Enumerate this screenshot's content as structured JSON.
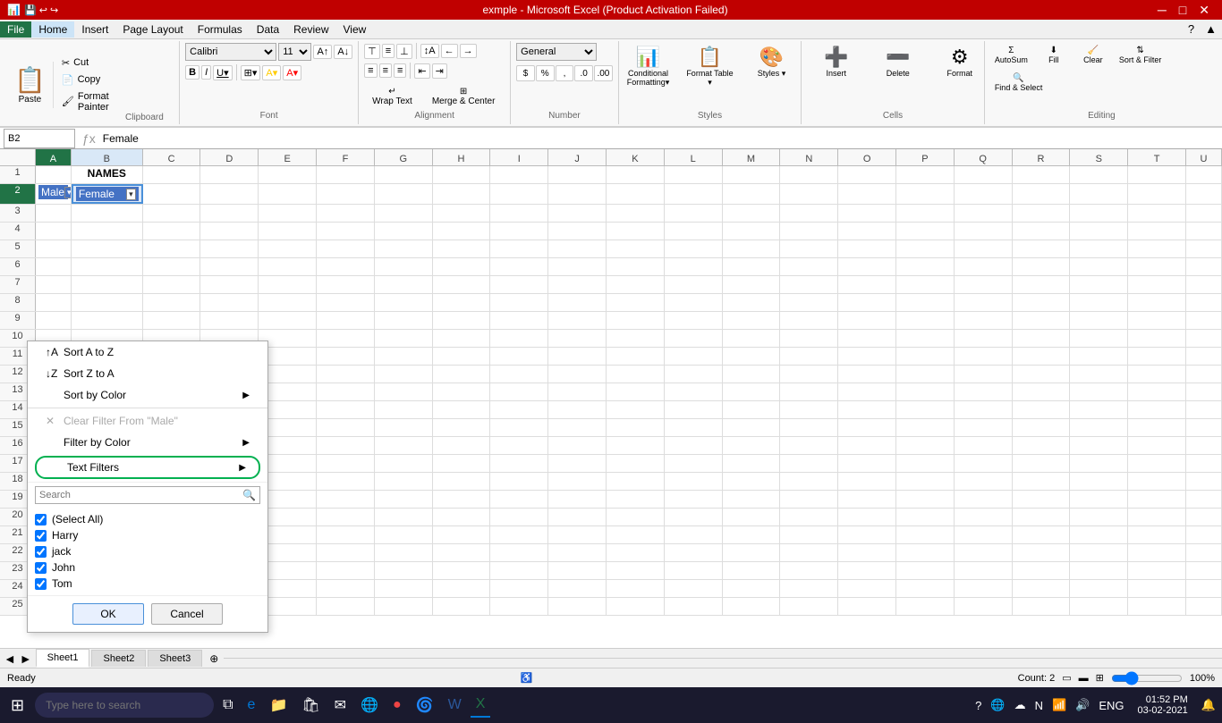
{
  "titleBar": {
    "title": "exmple - Microsoft Excel (Product Activation Failed)",
    "windowControls": [
      "_",
      "□",
      "✕"
    ]
  },
  "menuBar": {
    "items": [
      "File",
      "Home",
      "Insert",
      "Page Layout",
      "Formulas",
      "Data",
      "Review",
      "View"
    ]
  },
  "ribbon": {
    "clipboard": {
      "label": "Clipboard",
      "paste": "Paste",
      "cut": "Cut",
      "copy": "Copy",
      "formatPainter": "Format Painter"
    },
    "font": {
      "label": "Font",
      "fontName": "Calibri",
      "fontSize": "11",
      "bold": "B",
      "italic": "I",
      "underline": "U"
    },
    "alignment": {
      "label": "Alignment",
      "wrapText": "Wrap Text",
      "mergeCenter": "Merge & Center"
    },
    "number": {
      "label": "Number",
      "format": "General",
      "percent": "%",
      "comma": ","
    },
    "styles": {
      "label": "Styles",
      "conditionalFormatting": "Conditional Formatting",
      "formatAsTable": "Format Table",
      "cellStyles": "Cell Styles"
    },
    "cells": {
      "label": "Cells",
      "insert": "Insert",
      "delete": "Delete",
      "format": "Format"
    },
    "editing": {
      "label": "Editing",
      "autoSum": "AutoSum",
      "fill": "Fill",
      "clear": "Clear",
      "sortFilter": "Sort & Filter",
      "findSelect": "Find & Select"
    }
  },
  "formulaBar": {
    "cellRef": "B2",
    "formula": "Female"
  },
  "columns": [
    "A",
    "B",
    "C",
    "D",
    "E",
    "F",
    "G",
    "H",
    "I",
    "J",
    "K",
    "L",
    "M",
    "N",
    "O",
    "P",
    "Q",
    "R",
    "S",
    "T",
    "U"
  ],
  "rows": [
    {
      "num": 1,
      "cells": [
        "",
        "NAMES",
        "",
        "",
        "",
        "",
        "",
        "",
        "",
        "",
        "",
        "",
        "",
        "",
        "",
        "",
        "",
        "",
        "",
        "",
        ""
      ]
    },
    {
      "num": 2,
      "cells": [
        "",
        "Female",
        "",
        "",
        "",
        "",
        "",
        "",
        "",
        "",
        "",
        "",
        "",
        "",
        "",
        "",
        "",
        "",
        "",
        "",
        ""
      ]
    },
    {
      "num": 3,
      "cells": [
        "",
        "",
        "",
        "",
        "",
        "",
        "",
        "",
        "",
        "",
        "",
        "",
        "",
        "",
        "",
        "",
        "",
        "",
        "",
        "",
        ""
      ]
    },
    {
      "num": 4,
      "cells": [
        "",
        "",
        "",
        "",
        "",
        "",
        "",
        "",
        "",
        "",
        "",
        "",
        "",
        "",
        "",
        "",
        "",
        "",
        "",
        "",
        ""
      ]
    },
    {
      "num": 5,
      "cells": [
        "",
        "",
        "",
        "",
        "",
        "",
        "",
        "",
        "",
        "",
        "",
        "",
        "",
        "",
        "",
        "",
        "",
        "",
        "",
        "",
        ""
      ]
    }
  ],
  "dropdownMenu": {
    "items": [
      {
        "id": "sort-a-z",
        "label": "Sort A to Z",
        "icon": "↑",
        "disabled": false
      },
      {
        "id": "sort-z-a",
        "label": "Sort Z to A",
        "icon": "↓",
        "disabled": false
      },
      {
        "id": "sort-by-color",
        "label": "Sort by Color",
        "icon": "▶",
        "hasArrow": true,
        "disabled": false
      },
      {
        "sep": true
      },
      {
        "id": "clear-filter",
        "label": "Clear Filter From \"Male\"",
        "icon": "✕",
        "disabled": true
      },
      {
        "id": "filter-by-color",
        "label": "Filter by Color",
        "icon": "",
        "hasArrow": true,
        "disabled": false
      },
      {
        "id": "text-filters",
        "label": "Text Filters",
        "icon": "",
        "hasArrow": true,
        "disabled": false,
        "highlighted": true
      },
      {
        "sep2": true
      }
    ],
    "searchPlaceholder": "Search",
    "checkboxItems": [
      {
        "label": "(Select All)",
        "checked": true
      },
      {
        "label": "Harry",
        "checked": true
      },
      {
        "label": "jack",
        "checked": true
      },
      {
        "label": "John",
        "checked": true
      },
      {
        "label": "Tom",
        "checked": true
      }
    ],
    "buttons": {
      "ok": "OK",
      "cancel": "Cancel"
    }
  },
  "sheetTabs": {
    "tabs": [
      "Sheet1",
      "Sheet2",
      "Sheet3"
    ],
    "activeTab": "Sheet1"
  },
  "statusBar": {
    "left": "Ready",
    "count": "Count: 2",
    "zoom": "100%"
  },
  "taskbar": {
    "searchPlaceholder": "Type here to search",
    "clock": "01:52 PM",
    "date": "03-02-2021",
    "language": "ENG"
  }
}
